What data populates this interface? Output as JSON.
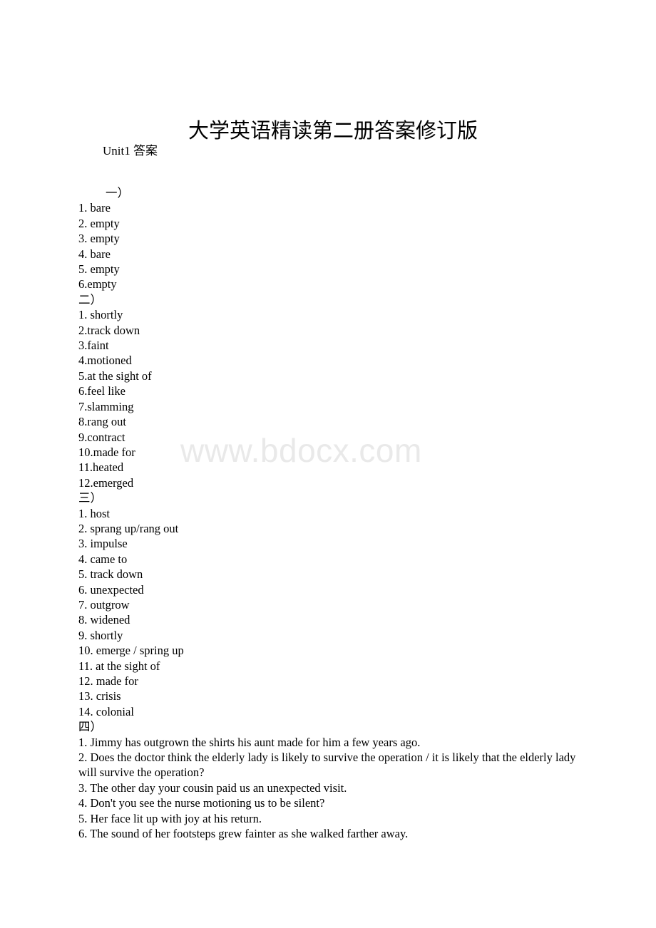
{
  "document": {
    "title": "大学英语精读第二册答案修订版",
    "unit_heading": "Unit1 答案",
    "watermark": "www.bdocx.com"
  },
  "sections": [
    {
      "label": "一）",
      "label_indented": true,
      "items": [
        "1. bare",
        "2. empty",
        "3. empty",
        "4. bare",
        "5. empty",
        "6.empty"
      ]
    },
    {
      "label": "二）",
      "label_indented": false,
      "items": [
        "1. shortly",
        "2.track down",
        "3.faint",
        "4.motioned",
        "5.at the sight of",
        "6.feel like",
        "7.slamming",
        "8.rang out",
        "9.contract",
        "10.made for",
        "11.heated",
        "12.emerged"
      ]
    },
    {
      "label": "三）",
      "label_indented": false,
      "items": [
        "1. host",
        "2. sprang up/rang out",
        "3. impulse",
        "4. came to",
        "5. track down",
        "6. unexpected",
        "7. outgrow",
        "8. widened",
        "9. shortly",
        "10. emerge / spring up",
        "11. at the sight of",
        "12. made for",
        "13. crisis",
        "14. colonial"
      ]
    },
    {
      "label": "四）",
      "label_indented": false,
      "items": [
        "1. Jimmy has outgrown the shirts his aunt made for him a few years ago.",
        "2. Does the doctor think the elderly lady is likely to survive the operation / it is likely that the elderly lady will survive the operation?",
        "3. The other day your cousin paid us an unexpected visit.",
        "4. Don't you see the nurse motioning us to be silent?",
        "5. Her face lit up with joy at his return.",
        "6. The sound of her footsteps grew fainter as she walked farther away."
      ]
    }
  ]
}
